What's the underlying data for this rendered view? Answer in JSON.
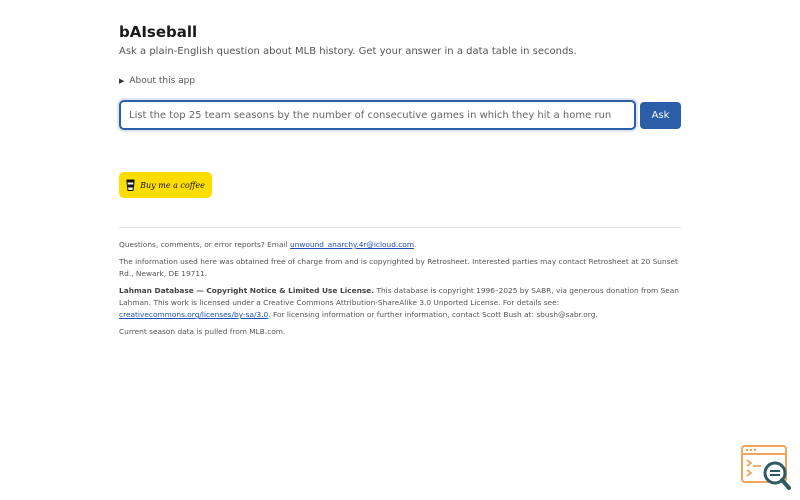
{
  "header": {
    "title": "bAIseball",
    "subtitle": "Ask a plain-English question about MLB history. Get your answer in a data table in seconds."
  },
  "about": {
    "label": "About this app"
  },
  "query": {
    "placeholder": "List the top 25 team seasons by the number of consecutive games in which they hit a home run",
    "ask_label": "Ask"
  },
  "coffee": {
    "label": "Buy me a coffee"
  },
  "footer": {
    "contact_prefix": "Questions, comments, or error reports? Email ",
    "contact_email": "unwound_anarchy.4r@icloud.com",
    "contact_suffix": ".",
    "retrosheet": "The information used here was obtained free of charge from and is copyrighted by Retrosheet. Interested parties may contact Retrosheet at 20 Sunset Rd., Newark, DE 19711.",
    "lahman_bold": "Lahman Database — Copyright Notice & Limited Use License.",
    "lahman_text": " This database is copyright 1996–2025 by SABR, via generous donation from Sean Lahman. This work is licensed under a Creative Commons Attribution-ShareAlike 3.0 Unported License. For details see: ",
    "lahman_link": "creativecommons.org/licenses/by-sa/3.0",
    "lahman_suffix": ". For licensing information or further information, contact Scott Bush at: sbush@sabr.org.",
    "mlb": "Current season data is pulled from MLB.com."
  },
  "colors": {
    "accent": "#2a5ea8",
    "coffee": "#ffdd00",
    "icon_orange": "#f0a55a",
    "icon_teal": "#2e5a66"
  },
  "icons": {
    "about_toggle": "triangle-right-icon",
    "coffee": "coffee-cup-icon",
    "corner": "search-document-icon"
  }
}
